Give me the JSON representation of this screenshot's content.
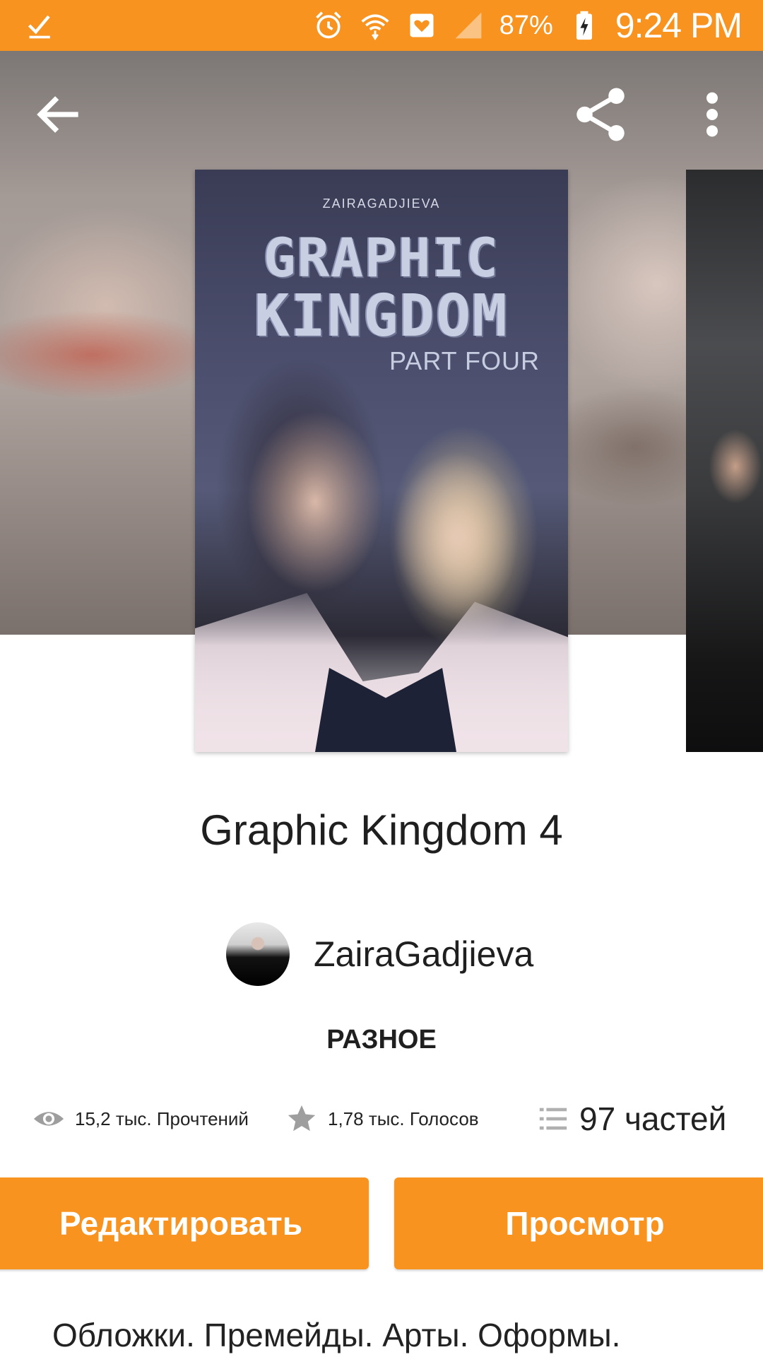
{
  "status_bar": {
    "battery": "87%",
    "time": "9:24 PM",
    "icons": [
      "download-done-icon",
      "alarm-icon",
      "wifi-icon",
      "heart-notification-icon",
      "signal-icon",
      "battery-charging-icon"
    ],
    "background": "#f7931e"
  },
  "toolbar": {
    "back_icon": "arrow-left-icon",
    "share_icon": "share-icon",
    "more_icon": "more-vert-icon"
  },
  "cover": {
    "author_tag": "ZAIRAGADJIEVA",
    "title_line1": "GRAPHIC",
    "title_line2": "KINGDOM",
    "subtitle": "PART FOUR"
  },
  "book": {
    "title": "Graphic Kingdom 4",
    "author": "ZairaGadjieva",
    "category": "РАЗНОЕ"
  },
  "stats": {
    "reads": "15,2 тыс. Прочтений",
    "votes": "1,78 тыс. Голосов",
    "parts": "97 частей"
  },
  "actions": {
    "edit_label": "Редактировать",
    "view_label": "Просмотр",
    "accent": "#f7931e"
  },
  "description": "Обложки. Премейды. Арты. Оформы."
}
